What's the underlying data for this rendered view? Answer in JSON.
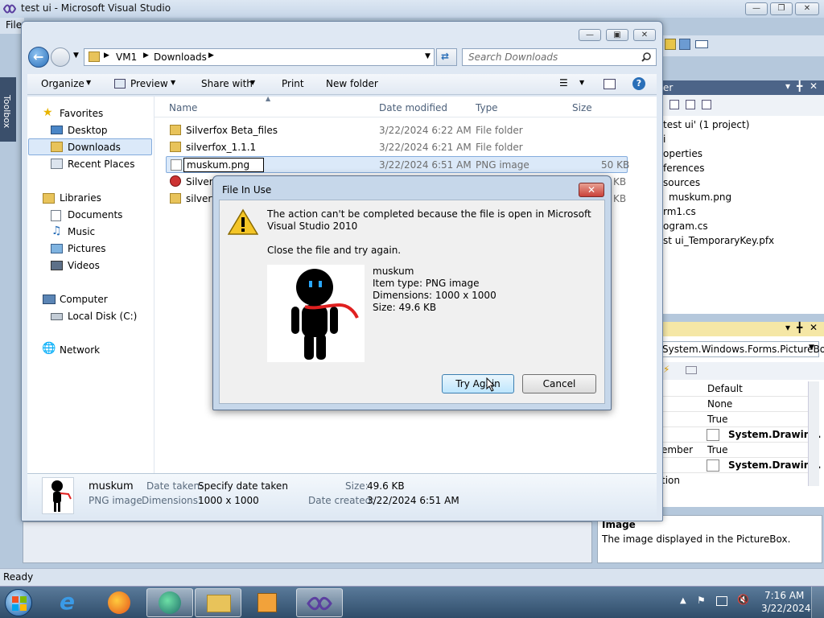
{
  "vs": {
    "title": "test ui - Microsoft Visual Studio",
    "menu_file": "File",
    "toolbox": "Toolbox",
    "status": "Ready",
    "solution_header": "er",
    "solution_items": [
      "test ui' (1 project)",
      "i",
      "operties",
      "ferences",
      "sources",
      "muskum.png",
      "rm1.cs",
      "ogram.cs",
      "st ui_TemporaryKey.pfx"
    ],
    "props_type": "System.Windows.Forms.PictureBo",
    "props_rows": [
      {
        "name": "",
        "value": "Default"
      },
      {
        "name": "",
        "value": "None"
      },
      {
        "name": "",
        "value": "True"
      },
      {
        "name": "",
        "value": "System.Drawing."
      },
      {
        "name": "ember",
        "value": "True"
      },
      {
        "name": "",
        "value": "System.Drawing."
      },
      {
        "name": "tion",
        "value": ""
      }
    ],
    "desc_title": "Image",
    "desc_text": "The image displayed in the PictureBox."
  },
  "explorer": {
    "breadcrumb": [
      "VM1",
      "Downloads"
    ],
    "search_placeholder": "Search Downloads",
    "toolbar": {
      "organize": "Organize",
      "preview": "Preview",
      "share_with": "Share with",
      "print": "Print",
      "new_folder": "New folder"
    },
    "nav": {
      "favorites": "Favorites",
      "desktop": "Desktop",
      "downloads": "Downloads",
      "recent_places": "Recent Places",
      "libraries": "Libraries",
      "documents": "Documents",
      "music": "Music",
      "pictures": "Pictures",
      "videos": "Videos",
      "computer": "Computer",
      "local_disk": "Local Disk (C:)",
      "network": "Network"
    },
    "columns": {
      "name": "Name",
      "date": "Date modified",
      "type": "Type",
      "size": "Size"
    },
    "files": [
      {
        "name": "Silverfox Beta_files",
        "date": "3/22/2024 6:22 AM",
        "type": "File folder",
        "size": ""
      },
      {
        "name": "silverfox_1.1.1",
        "date": "3/22/2024 6:21 AM",
        "type": "File folder",
        "size": ""
      },
      {
        "name": "muskum.png",
        "date": "3/22/2024 6:51 AM",
        "type": "PNG image",
        "size": "50 KB"
      },
      {
        "name": "Silverf",
        "date": "",
        "type": "",
        "size": "KB"
      },
      {
        "name": "silverf",
        "date": "",
        "type": "",
        "size": "KB"
      }
    ],
    "details": {
      "name": "muskum",
      "type": "PNG image",
      "date_taken_label": "Date taken:",
      "date_taken_value": "Specify date taken",
      "dimensions_label": "Dimensions:",
      "dimensions_value": "1000 x 1000",
      "size_label": "Size:",
      "size_value": "49.6 KB",
      "created_label": "Date created:",
      "created_value": "3/22/2024 6:51 AM"
    }
  },
  "dialog": {
    "title": "File In Use",
    "message": "The action can't be completed because the file is open in Microsoft Visual Studio 2010",
    "instruction": "Close the file and try again.",
    "file_name": "muskum",
    "item_type": "Item type: PNG image",
    "dimensions": "Dimensions: 1000 x 1000",
    "size": "Size: 49.6 KB",
    "try_again": "Try Again",
    "cancel": "Cancel"
  },
  "taskbar": {
    "time": "7:16 AM",
    "date": "3/22/2024"
  },
  "colors": {
    "accent": "#3c7fb1",
    "title_bar": "#c6d7ea",
    "selection": "#dbe9f9",
    "close_button": "#c9413a"
  }
}
